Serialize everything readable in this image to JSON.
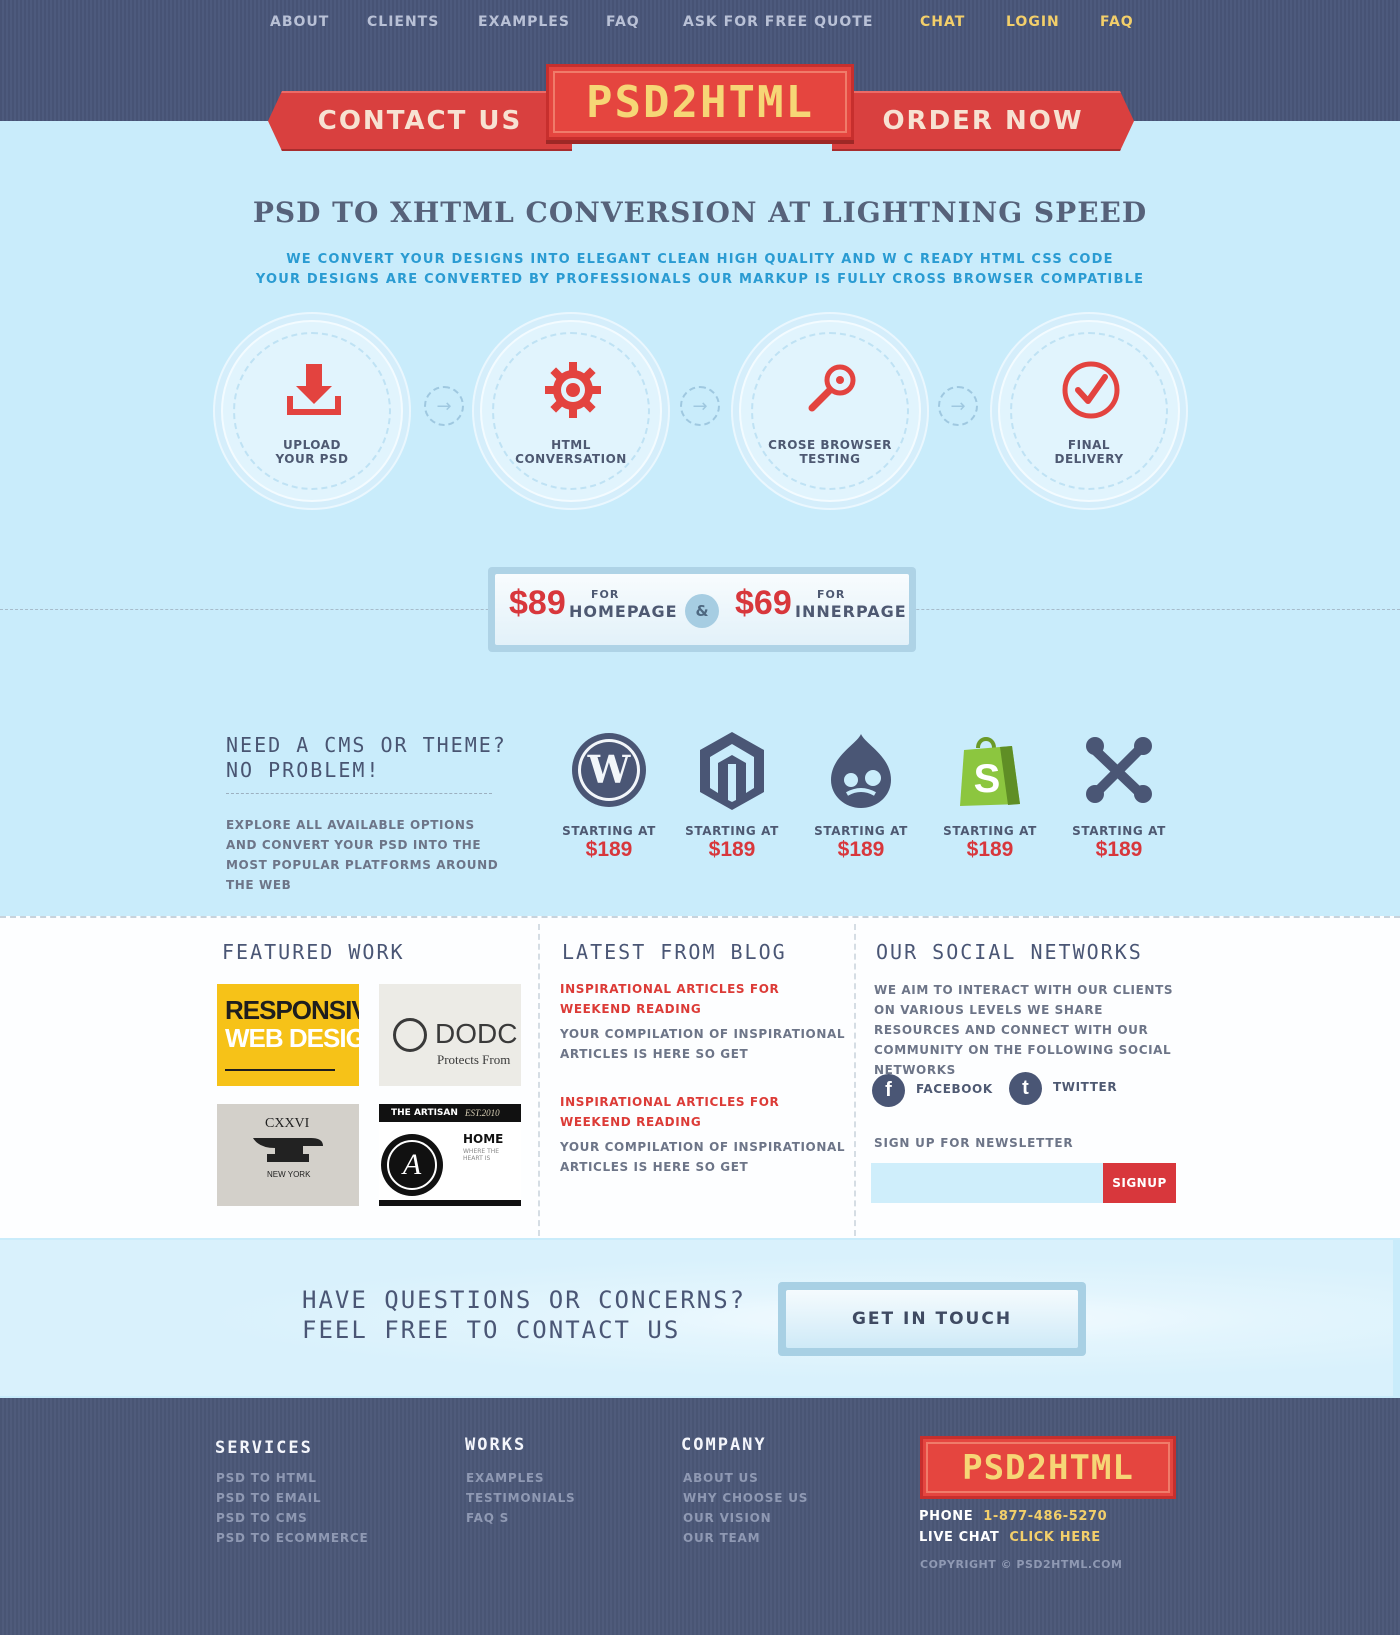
{
  "nav": {
    "left": [
      "ABOUT",
      "CLIENTS",
      "EXAMPLES",
      "FAQ",
      "ASK FOR FREE QUOTE"
    ],
    "right": [
      "CHAT",
      "LOGIN",
      "FAQ"
    ]
  },
  "header": {
    "contact": "CONTACT US",
    "logo": "PSD2HTML",
    "order": "ORDER NOW"
  },
  "hero": {
    "title": "PSD TO XHTML CONVERSION AT LIGHTNING SPEED",
    "sub1": "WE CONVERT YOUR DESIGNS INTO ELEGANT  CLEAN  HIGH QUALITY AND W C READY HTML CSS CODE",
    "sub2": "YOUR DESIGNS ARE CONVERTED BY PROFESSIONALS OUR MARKUP IS FULLY CROSS BROWSER COMPATIBLE"
  },
  "steps": [
    {
      "line1": "UPLOAD",
      "line2": "YOUR PSD",
      "icon": "download-icon"
    },
    {
      "line1": "HTML",
      "line2": "CONVERSATION",
      "icon": "gear-icon"
    },
    {
      "line1": "CROSE BROWSER",
      "line2": "TESTING",
      "icon": "magnifier-icon"
    },
    {
      "line1": "FINAL",
      "line2": "DELIVERY",
      "icon": "check-icon"
    }
  ],
  "pricing": {
    "home_price": "$89",
    "home_for": "FOR",
    "home_label": "HOMEPAGE",
    "amp": "&",
    "inner_price": "$69",
    "inner_for": "FOR",
    "inner_label": "INNERPAGE"
  },
  "cms": {
    "title1": "NEED A CMS OR THEME?",
    "title2": "NO PROBLEM!",
    "desc": "EXPLORE ALL AVAILABLE OPTIONS AND CONVERT YOUR PSD INTO THE MOST POPULAR PLATFORMS AROUND THE WEB",
    "items": [
      {
        "icon": "wordpress-icon",
        "starting": "STARTING AT",
        "price": "$189"
      },
      {
        "icon": "magento-icon",
        "starting": "STARTING AT",
        "price": "$189"
      },
      {
        "icon": "drupal-icon",
        "starting": "STARTING AT",
        "price": "$189"
      },
      {
        "icon": "shopify-icon",
        "starting": "STARTING AT",
        "price": "$189"
      },
      {
        "icon": "joomla-icon",
        "starting": "STARTING AT",
        "price": "$189"
      }
    ]
  },
  "featured": {
    "title": "FEATURED WORK",
    "thumb1_line1": "RESPONSIVE",
    "thumb1_line2": "WEB DESIGN",
    "thumb2_brand": "DODC",
    "thumb2_sub": "Protects From",
    "thumb3_text": "CXXVI",
    "thumb3_sub": "NEW YORK",
    "thumb4_top": "THE ARTISAN",
    "thumb4_est": "EST.2010",
    "thumb4_home": "HOME",
    "thumb4_sub": "WHERE THE HEART IS"
  },
  "blog": {
    "title": "LATEST FROM BLOG",
    "posts": [
      {
        "title": "INSPIRATIONAL ARTICLES FOR WEEKEND READING",
        "text": "YOUR COMPILATION OF INSPIRATIONAL ARTICLES IS HERE  SO  GET"
      },
      {
        "title": "INSPIRATIONAL ARTICLES FOR WEEKEND READING",
        "text": "YOUR COMPILATION OF INSPIRATIONAL ARTICLES IS HERE  SO  GET"
      }
    ]
  },
  "social": {
    "title": "OUR SOCIAL NETWORKS",
    "text": "WE AIM TO INTERACT WITH OUR CLIENTS ON VARIOUS LEVELS  WE SHARE RESOURCES AND CONNECT WITH OUR COMMUNITY ON THE FOLLOWING SOCIAL NETWORKS",
    "facebook": "FACEBOOK",
    "twitter": "TWITTER",
    "newsletter_label": "SIGN UP FOR NEWSLETTER",
    "newsletter_placeholder": "",
    "signup": "SIGNUP"
  },
  "band": {
    "line1": "HAVE QUESTIONS OR CONCERNS?",
    "line2": "FEEL FREE TO CONTACT US",
    "button": "GET IN TOUCH"
  },
  "footer": {
    "services_title": "SERVICES",
    "services": [
      "PSD TO HTML",
      "PSD TO EMAIL",
      "PSD TO CMS",
      "PSD TO ECOMMERCE"
    ],
    "works_title": "WORKS",
    "works": [
      "EXAMPLES",
      "TESTIMONIALS",
      "FAQ S"
    ],
    "company_title": "COMPANY",
    "company": [
      "ABOUT US",
      "WHY CHOOSE US",
      "OUR VISION",
      "OUR TEAM"
    ],
    "logo": "PSD2HTML",
    "phone_label": "PHONE",
    "phone": "1-877-486-5270",
    "chat_label": "LIVE CHAT",
    "chat_link": "CLICK HERE",
    "copyright": "COPYRIGHT © PSD2HTML.COM"
  },
  "colors": {
    "red": "#d8373c",
    "navy": "#495574",
    "sky": "#c9ecfb",
    "yellow": "#f3cf6a"
  }
}
